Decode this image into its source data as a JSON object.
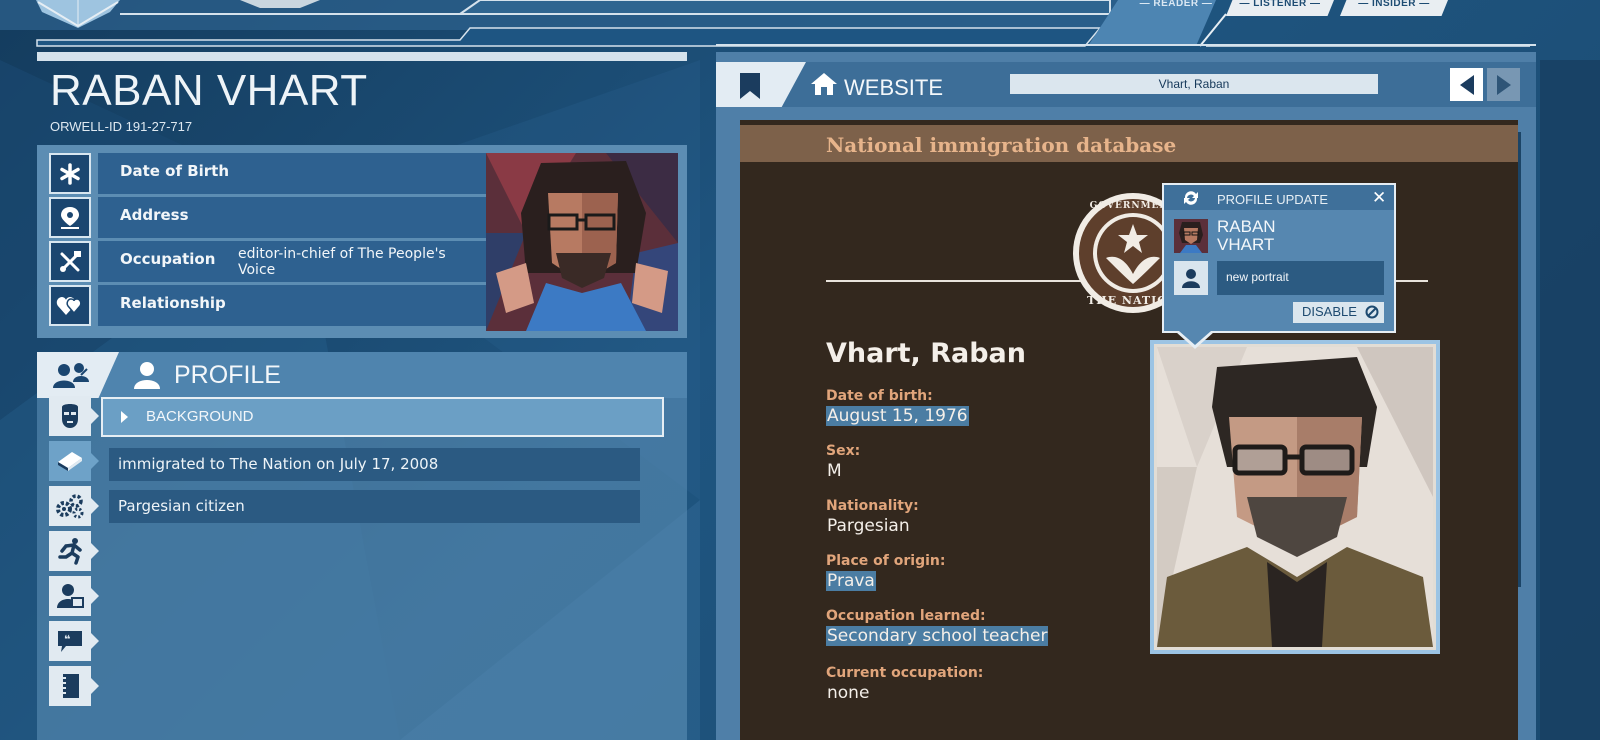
{
  "top_bar": {
    "modes": [
      "— READER —",
      "— LISTENER —",
      "— INSIDER —"
    ],
    "active_mode": "— READER —"
  },
  "person": {
    "name": "RABAN VHART",
    "orwell_id": "ORWELL-ID  191-27-717"
  },
  "info_card": {
    "rows": [
      {
        "label": "Date of Birth",
        "value": "",
        "icon": "asterisk-icon"
      },
      {
        "label": "Address",
        "value": "",
        "icon": "location-pin-icon"
      },
      {
        "label": "Occupation",
        "value": "editor-in-chief of The People's Voice",
        "icon": "tools-icon"
      },
      {
        "label": "Relationship",
        "value": "",
        "icon": "hearts-icon"
      }
    ]
  },
  "profile": {
    "title": "PROFILE",
    "section": "BACKGROUND",
    "entries": [
      "immigrated to The Nation on July 17, 2008",
      "Pargesian citizen"
    ],
    "side_icons": [
      "face-icon",
      "book-icon",
      "gears-icon",
      "running-icon",
      "person-badge-icon",
      "speech-bubble-icon",
      "notebook-icon"
    ]
  },
  "browser": {
    "tab_label": "WEBSITE",
    "url": "Vhart, Raban"
  },
  "webpage": {
    "site_title": "National immigration database",
    "seal_text": "GOVERNMENT · THE NATION",
    "record_name": "Vhart, Raban",
    "fields": [
      {
        "label": "Date of birth:",
        "value": "August 15, 1976",
        "highlighted": true
      },
      {
        "label": "Sex:",
        "value": "M",
        "highlighted": false
      },
      {
        "label": "Nationality:",
        "value": "Pargesian",
        "highlighted": false
      },
      {
        "label": "Place of origin:",
        "value": "Prava",
        "highlighted": true
      },
      {
        "label": "Occupation learned:",
        "value": "Secondary school teacher",
        "highlighted": true
      },
      {
        "label": "Current occupation:",
        "value": "none",
        "highlighted": false
      }
    ]
  },
  "popup": {
    "title": "PROFILE UPDATE",
    "close": "✕",
    "name_line1": "RABAN",
    "name_line2": "VHART",
    "detail": "new portrait",
    "disable_label": "DISABLE"
  },
  "colors": {
    "background": "#1f5580",
    "panel_dark": "#2e6190",
    "webpage_bg": "#33281e",
    "webpage_accent": "#e1a57b",
    "highlight": "#4b7da3"
  }
}
